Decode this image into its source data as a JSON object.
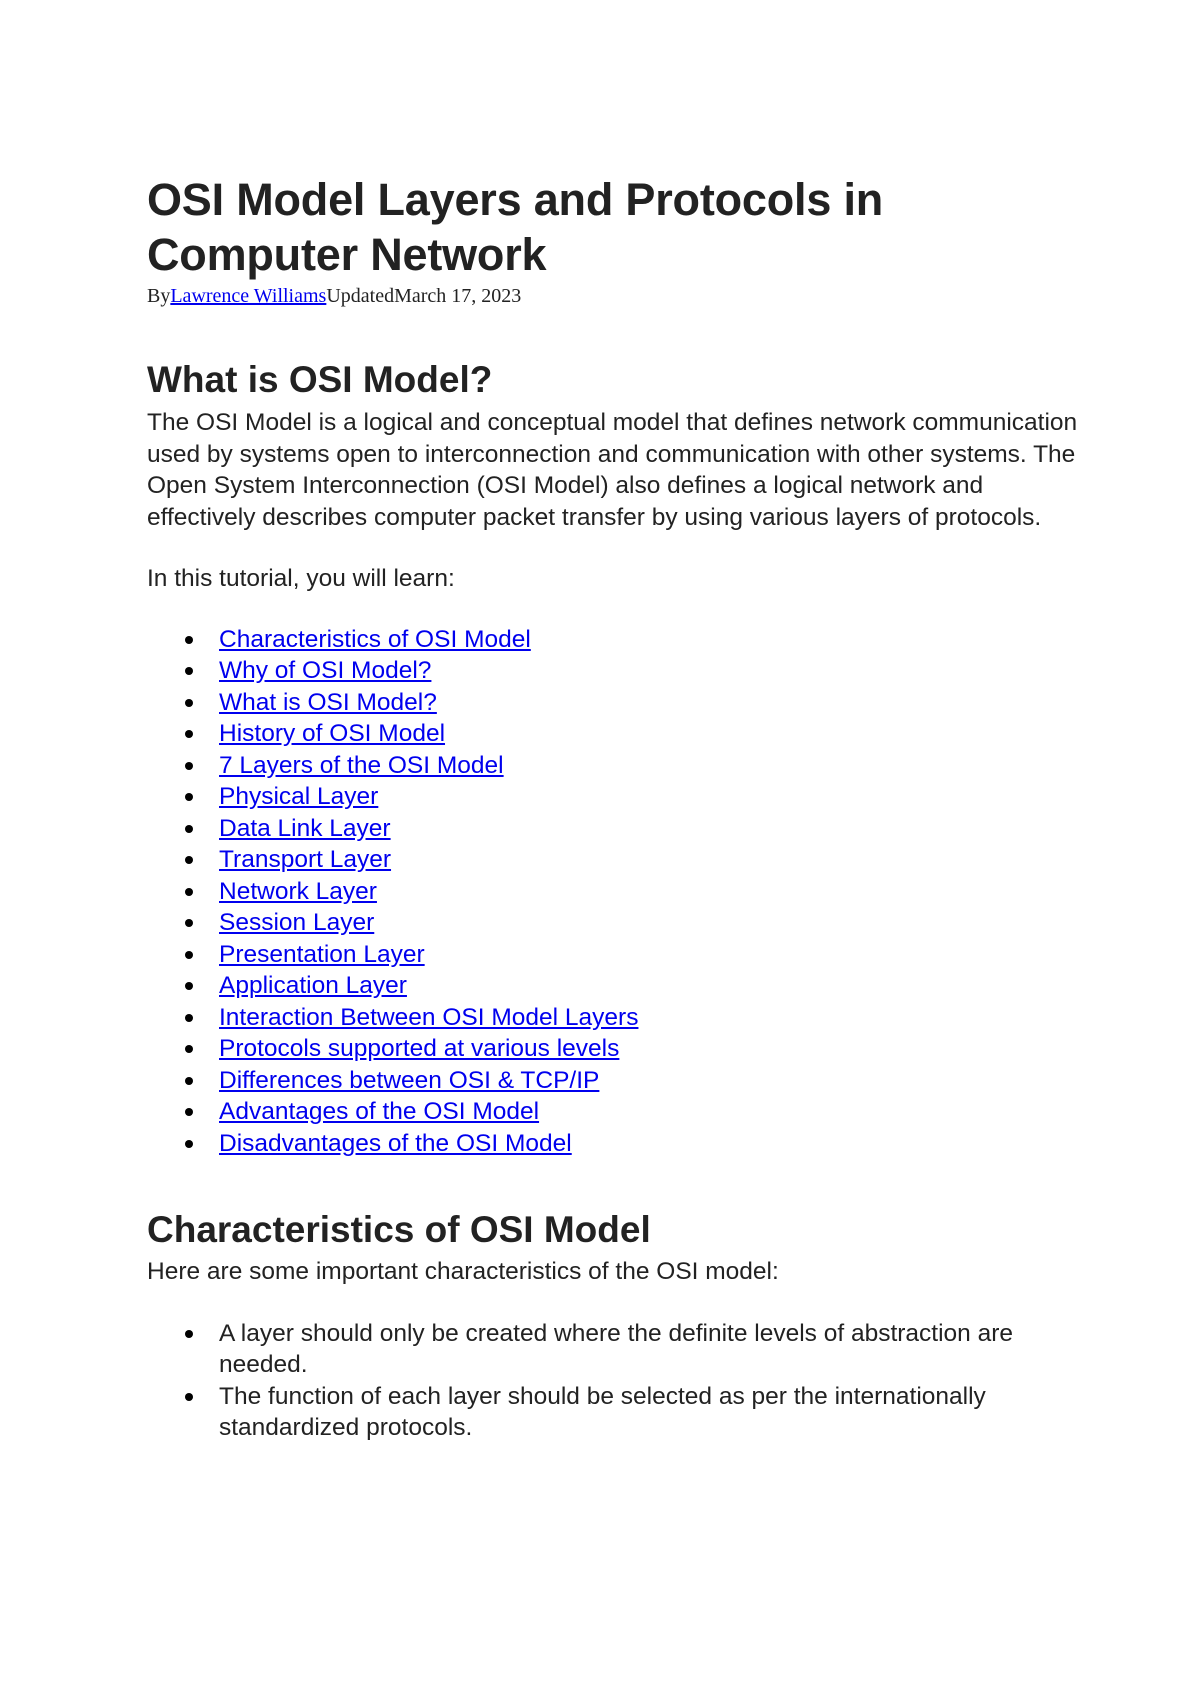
{
  "document": {
    "title": "OSI Model Layers and Protocols in Computer Network",
    "byline": {
      "by_label": "By",
      "author": "Lawrence Williams",
      "updated_label": "Updated",
      "date": "March 17, 2023"
    },
    "colors": {
      "text": "#222222",
      "link": "#0000ee"
    }
  },
  "section_what": {
    "heading": "What is OSI Model?",
    "paragraph": "The OSI Model is a logical and conceptual model that defines network communication used by systems open to interconnection and communication with other systems. The Open System Interconnection (OSI Model) also defines a logical network and effectively describes computer packet transfer by using various layers of protocols.",
    "learn_intro": "In this tutorial, you will learn:",
    "toc": [
      "Characteristics of OSI Model",
      "Why of OSI Model?",
      "What is OSI Model?",
      "History of OSI Model",
      "7 Layers of the OSI Model",
      "Physical Layer",
      "Data Link Layer",
      "Transport Layer",
      "Network Layer",
      "Session Layer",
      "Presentation Layer",
      "Application Layer",
      "Interaction Between OSI Model Layers",
      "Protocols supported at various levels",
      "Differences between OSI & TCP/IP",
      "Advantages of the OSI Model",
      "Disadvantages of the OSI Model"
    ]
  },
  "section_characteristics": {
    "heading": "Characteristics of OSI Model",
    "intro": "Here are some important characteristics of the OSI model:",
    "bullets": [
      "A layer should only be created where the definite levels of abstraction are needed.",
      "The function of each layer should be selected as per the internationally standardized protocols."
    ]
  }
}
